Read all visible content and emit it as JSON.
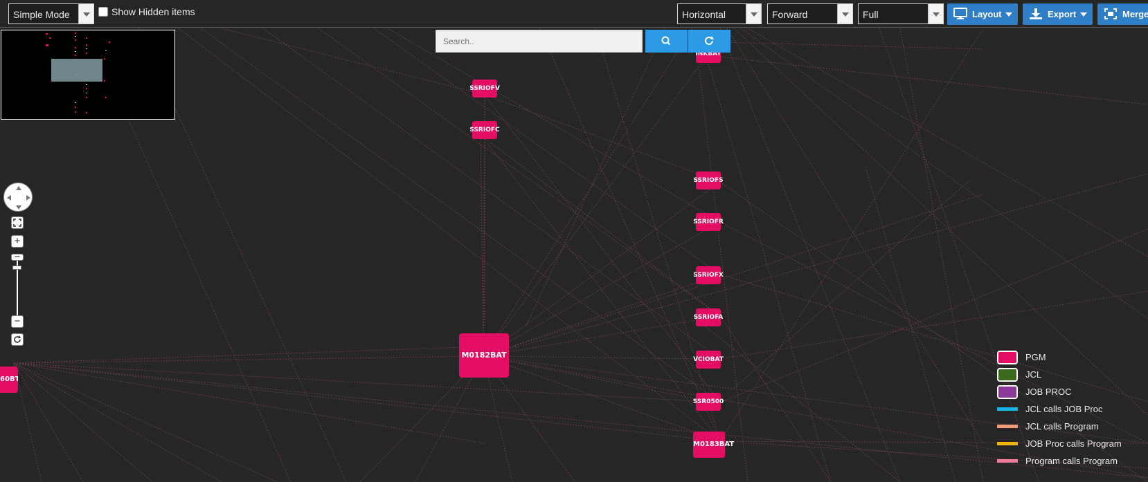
{
  "toolbar": {
    "mode_select": "Simple Mode",
    "show_hidden_label": "Show Hidden items",
    "orientation_select": "Horizontal",
    "direction_select": "Forward",
    "scope_select": "Full",
    "layout_button": "Layout",
    "export_button": "Export",
    "merge_button": "Merge"
  },
  "search": {
    "placeholder": "Search..",
    "search_icon": "search-icon",
    "refresh_icon": "refresh-icon"
  },
  "nodes": {
    "inkbat": "INKBAT",
    "ssriofv": "SSRIOFV",
    "ssriofc": "SSRIOFC",
    "ssriofs": "SSRIOFS",
    "ssriofr": "SSRIOFR",
    "ssriofx": "SSRIOFX",
    "ssriofa": "SSRIOFA",
    "m0182bat": "M0182BAT",
    "vciobat": "VCIOBAT",
    "ssr0500": "SSR0500",
    "m0183bat": "M0183BAT",
    "left_node": "60BT"
  },
  "legend": {
    "items": [
      {
        "label": "PGM",
        "color": "#e30d63",
        "kind": "box"
      },
      {
        "label": "JCL",
        "color": "#3a6b1c",
        "kind": "box"
      },
      {
        "label": "JOB PROC",
        "color": "#8b3a9a",
        "kind": "box"
      },
      {
        "label": "JCL calls JOB Proc",
        "color": "#1ab3e6",
        "kind": "line"
      },
      {
        "label": "JCL calls Program",
        "color": "#f29b7a",
        "kind": "line"
      },
      {
        "label": "JOB Proc calls Program",
        "color": "#f2b70f",
        "kind": "line"
      },
      {
        "label": "Program calls Program",
        "color": "#f07d9b",
        "kind": "line"
      }
    ]
  },
  "colors": {
    "background": "#262626",
    "pgm": "#e30d63",
    "edge": "#8c4a5c",
    "button": "#2f7ec8",
    "search_button": "#2d9ae6"
  }
}
